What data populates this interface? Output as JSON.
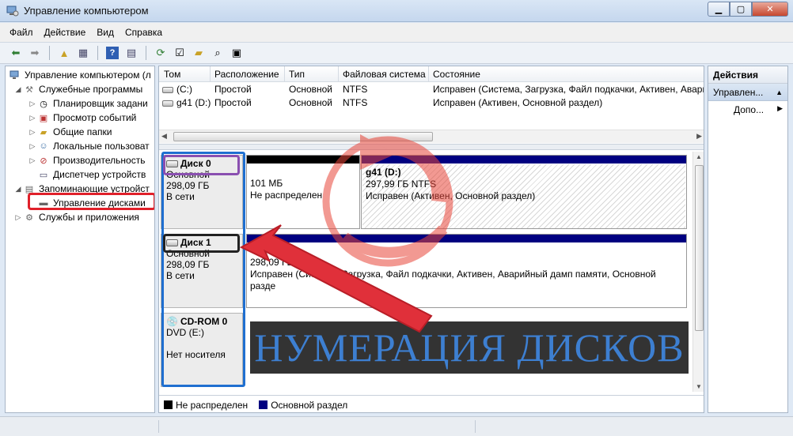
{
  "window": {
    "title": "Управление компьютером",
    "minimize_glyph": "▭",
    "maximize_glyph": "▢",
    "close_glyph": "✕"
  },
  "menu": [
    "Файл",
    "Действие",
    "Вид",
    "Справка"
  ],
  "tree": {
    "root": "Управление компьютером (л",
    "items": [
      {
        "label": "Служебные программы",
        "icon": "tools-icon"
      },
      {
        "label": "Планировщик задани",
        "icon": "clock-icon"
      },
      {
        "label": "Просмотр событий",
        "icon": "event-viewer-icon"
      },
      {
        "label": "Общие папки",
        "icon": "shared-folder-icon"
      },
      {
        "label": "Локальные пользоват",
        "icon": "users-icon"
      },
      {
        "label": "Производительность",
        "icon": "performance-icon"
      },
      {
        "label": "Диспетчер устройств",
        "icon": "device-manager-icon"
      },
      {
        "label": "Запоминающие устройст",
        "icon": "storage-icon"
      },
      {
        "label": "Управление дисками",
        "icon": "disk-management-icon"
      },
      {
        "label": "Службы и приложения",
        "icon": "services-icon"
      }
    ]
  },
  "volumes": {
    "columns": [
      "Том",
      "Расположение",
      "Тип",
      "Файловая система",
      "Состояние"
    ],
    "rows": [
      {
        "name": "(C:)",
        "layout": "Простой",
        "type": "Основной",
        "fs": "NTFS",
        "status": "Исправен (Система, Загрузка, Файл подкачки, Активен, Авари"
      },
      {
        "name": "g41 (D:)",
        "layout": "Простой",
        "type": "Основной",
        "fs": "NTFS",
        "status": "Исправен (Активен, Основной раздел)"
      }
    ]
  },
  "disks": [
    {
      "name": "Диск 0",
      "kind": "Основной",
      "size": "298,09 ГБ",
      "state": "В сети",
      "partitions": [
        {
          "size": "101 МБ",
          "status": "Не распределен",
          "kind": "unallocated"
        },
        {
          "title": "g41  (D:)",
          "size": "297,99 ГБ NTFS",
          "status": "Исправен (Активен, Основной раздел)",
          "kind": "primary"
        }
      ]
    },
    {
      "name": "Диск 1",
      "kind": "Основной",
      "size": "298,09 ГБ",
      "state": "В сети",
      "partitions": [
        {
          "size": "298,09 ГБ NTFS",
          "status": "Исправен (Система, Загрузка, Файл подкачки, Активен, Аварийный дамп памяти, Основной разде",
          "kind": "primary"
        }
      ]
    },
    {
      "name": "CD-ROM 0",
      "kind": "DVD (E:)",
      "state": "Нет носителя"
    }
  ],
  "legend": [
    {
      "label": "Не распределен",
      "color": "#000000"
    },
    {
      "label": "Основной раздел",
      "color": "#000080"
    }
  ],
  "actions": {
    "header": "Действия",
    "section": "Управлен...",
    "more": "Допо..."
  },
  "annotation": {
    "banner_text": "НУМЕРАЦИЯ ДИСКОВ",
    "colors": {
      "banner_bg": "#333333",
      "banner_text": "#3d7fd1",
      "arrow": "#e0303a",
      "watermark": "#e8463a"
    }
  }
}
